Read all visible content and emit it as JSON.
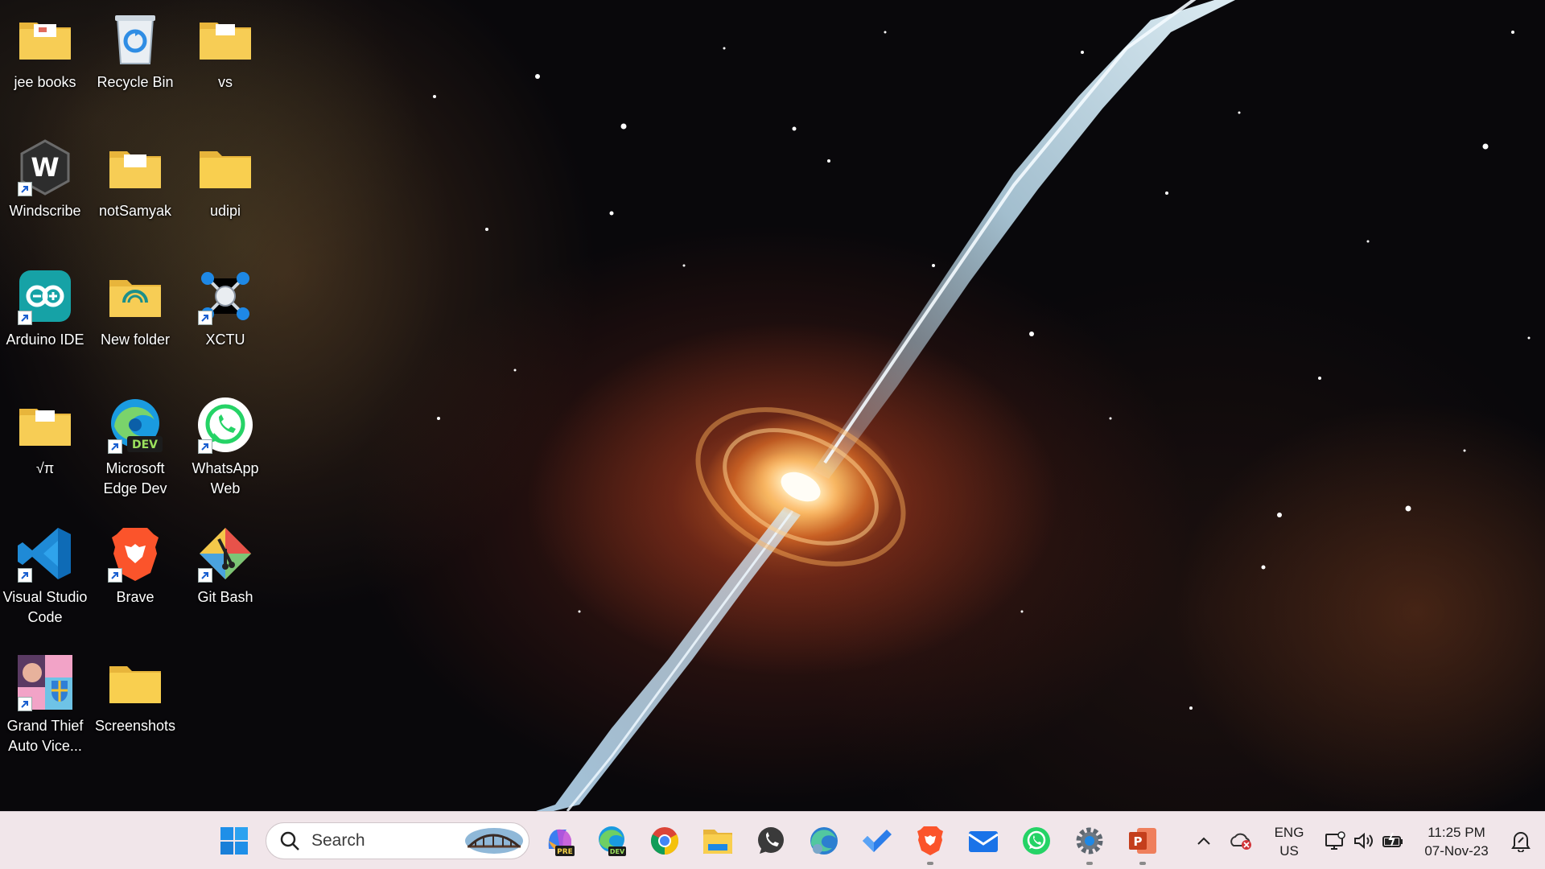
{
  "desktop": {
    "icons": [
      {
        "label": "jee books",
        "icon": "folder-icon"
      },
      {
        "label": "Recycle Bin",
        "icon": "recycle-bin-icon"
      },
      {
        "label": "vs",
        "icon": "folder-icon"
      },
      {
        "label": "Windscribe",
        "icon": "windscribe-icon",
        "shortcut": true
      },
      {
        "label": "notSamyak",
        "icon": "folder-icon"
      },
      {
        "label": "udipi",
        "icon": "folder-icon"
      },
      {
        "label": "Arduino IDE",
        "icon": "arduino-icon",
        "shortcut": true
      },
      {
        "label": "New folder",
        "icon": "folder-icon"
      },
      {
        "label": "XCTU",
        "icon": "xctu-icon",
        "shortcut": true
      },
      {
        "label": "√π",
        "icon": "folder-icon"
      },
      {
        "label": "Microsoft Edge Dev",
        "icon": "edge-dev-icon",
        "shortcut": true
      },
      {
        "label": "WhatsApp Web",
        "icon": "whatsapp-icon",
        "shortcut": true
      },
      {
        "label": "Visual Studio Code",
        "icon": "vscode-icon",
        "shortcut": true
      },
      {
        "label": "Brave",
        "icon": "brave-icon",
        "shortcut": true
      },
      {
        "label": "Git Bash",
        "icon": "git-bash-icon",
        "shortcut": true
      },
      {
        "label": "Grand Thief Auto Vice...",
        "icon": "gta-vice-city-icon",
        "shortcut": true
      },
      {
        "label": "Screenshots",
        "icon": "folder-icon"
      }
    ]
  },
  "taskbar": {
    "search_placeholder": "Search",
    "dev_badge": "DEV",
    "pre_badge": "PRE",
    "apps": [
      "start-icon",
      "copilot-pre-icon",
      "edge-dev-icon",
      "chrome-icon",
      "file-explorer-icon",
      "whatsapp-icon",
      "edge-beta-icon",
      "todo-icon",
      "brave-icon",
      "mail-icon",
      "whatsapp-web-icon",
      "settings-icon",
      "powerpoint-icon"
    ],
    "tray": {
      "lang_line1": "ENG",
      "lang_line2": "US",
      "time": "11:25 PM",
      "date": "07-Nov-23"
    }
  },
  "colors": {
    "folder": "#f6c94c",
    "taskbar": "#f1e6ea",
    "accent": "#0a6fd8"
  }
}
